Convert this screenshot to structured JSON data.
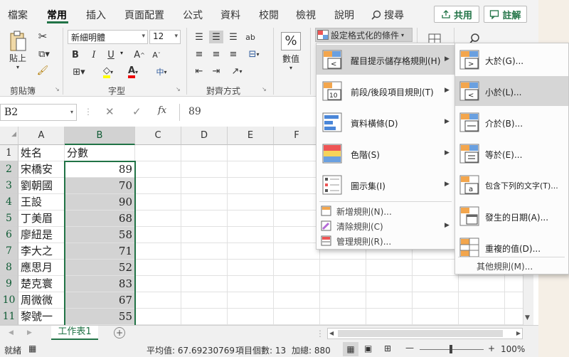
{
  "ribbon_tabs": [
    "檔案",
    "常用",
    "插入",
    "頁面配置",
    "公式",
    "資料",
    "校閱",
    "檢視",
    "說明"
  ],
  "search": {
    "label": "搜尋"
  },
  "share": {
    "label": "共用"
  },
  "comments": {
    "label": "註解"
  },
  "clipboard": {
    "paste_label": "貼上",
    "group_label": "剪貼簿"
  },
  "font": {
    "name": "新細明體",
    "size": "12",
    "bold": "B",
    "italic": "I",
    "underline": "U",
    "grow": "A",
    "shrink": "A",
    "group_label": "字型",
    "font_color_letter": "A",
    "phonetic": "中"
  },
  "alignment": {
    "group_label": "對齊方式"
  },
  "number": {
    "label": "數值",
    "symbol": "%"
  },
  "conditional_format": {
    "label": "設定格式化的條件"
  },
  "name_box": {
    "value": "B2"
  },
  "formula_bar": {
    "fx": "fx",
    "value": "89"
  },
  "columns": [
    "A",
    "B",
    "C",
    "D",
    "E",
    "F"
  ],
  "rows": [
    {
      "num": "1",
      "a": "姓名",
      "b": "分數"
    },
    {
      "num": "2",
      "a": "宋橋安",
      "b": "89"
    },
    {
      "num": "3",
      "a": "劉朝國",
      "b": "70"
    },
    {
      "num": "4",
      "a": "王設",
      "b": "90"
    },
    {
      "num": "5",
      "a": "丁美眉",
      "b": "68"
    },
    {
      "num": "6",
      "a": "廖紐是",
      "b": "58"
    },
    {
      "num": "7",
      "a": "李大之",
      "b": "71"
    },
    {
      "num": "8",
      "a": "應思月",
      "b": "52"
    },
    {
      "num": "9",
      "a": "楚克寰",
      "b": "83"
    },
    {
      "num": "10",
      "a": "周微微",
      "b": "67"
    },
    {
      "num": "11",
      "a": "黎號一",
      "b": "55"
    }
  ],
  "sheet_tab": {
    "label": "工作表1",
    "add": "+"
  },
  "status": {
    "ready": "就緒",
    "average": "平均值: 67.69230769",
    "count": "項目個數: 13",
    "sum": "加總: 880",
    "zoom": "100%"
  },
  "main_menu": {
    "items": [
      {
        "label": "醒目提示儲存格規則(H)",
        "submenu": true
      },
      {
        "label": "前段/後段項目規則(T)",
        "submenu": true
      },
      {
        "label": "資料橫條(D)",
        "submenu": true
      },
      {
        "label": "色階(S)",
        "submenu": true
      },
      {
        "label": "圖示集(I)",
        "submenu": true
      }
    ],
    "small_items": [
      {
        "label": "新增規則(N)..."
      },
      {
        "label": "清除規則(C)",
        "submenu": true
      },
      {
        "label": "管理規則(R)..."
      }
    ]
  },
  "sub_menu": {
    "items": [
      {
        "label": "大於(G)..."
      },
      {
        "label": "小於(L)..."
      },
      {
        "label": "介於(B)..."
      },
      {
        "label": "等於(E)..."
      },
      {
        "label": "包含下列的文字(T)..."
      },
      {
        "label": "發生的日期(A)..."
      },
      {
        "label": "重複的值(D)..."
      }
    ],
    "more": "其他規則(M)..."
  },
  "colors": {
    "accent": "#217346",
    "selection": "#d3d3d3",
    "hover": "#d6d6d6"
  }
}
